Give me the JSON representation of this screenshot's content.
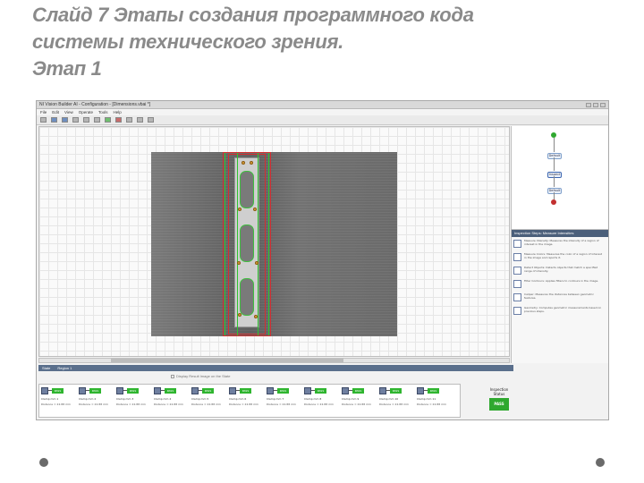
{
  "slide": {
    "title_lines": [
      "Слайд 7 Этапы создания программного кода",
      "системы технического зрения.",
      "Этап 1"
    ]
  },
  "app": {
    "window_title": "NI Vision Builder AI - Configuration - [Dimensions.vbai *]",
    "menu": [
      "File",
      "Edit",
      "View",
      "Operate",
      "Tools",
      "Help"
    ],
    "flow": {
      "start_label": "Start",
      "node1": "Default",
      "node2": "Inspect",
      "node3": "Default",
      "end_label": "End"
    },
    "panel_title": "Inspection Steps: Measure Intensities",
    "tools": [
      {
        "icon": "measure-intensity-icon",
        "text": "Measure Intensity: Measures the intensity of a region of interest in the image."
      },
      {
        "icon": "measure-colors-icon",
        "text": "Measure Colors: Measures the color of a region of interest in the image and reports it."
      },
      {
        "icon": "detect-objects-icon",
        "text": "Detect Objects: Detects objects that match a specified range of intensity."
      },
      {
        "icon": "filter-contours-icon",
        "text": "Filter Contours: Applies filters to contours in the image."
      },
      {
        "icon": "caliper-icon",
        "text": "Caliper: Measures the distances between geometric features."
      },
      {
        "icon": "geometry-icon",
        "text": "Geometry: Computes geometric measurements based on previous steps."
      }
    ],
    "bottom_tabs": [
      "State",
      "Region 1"
    ],
    "display_option": "Display Result Image on the State",
    "steps": [
      {
        "name": "Clamp mm 1",
        "value": "Distance = 22.88 mm"
      },
      {
        "name": "Clamp mm 2",
        "value": "Distance = 22.88 mm"
      },
      {
        "name": "Clamp mm 3",
        "value": "Distance = 22.88 mm"
      },
      {
        "name": "Clamp mm 4",
        "value": "Distance = 22.88 mm"
      },
      {
        "name": "Clamp mm 5",
        "value": "Distance = 22.88 mm"
      },
      {
        "name": "Clamp mm 6",
        "value": "Distance = 22.88 mm"
      },
      {
        "name": "Clamp mm 7",
        "value": "Distance = 22.88 mm"
      },
      {
        "name": "Clamp mm 8",
        "value": "Distance = 22.88 mm"
      },
      {
        "name": "Clamp mm 9",
        "value": "Distance = 22.88 mm"
      },
      {
        "name": "Clamp mm 10",
        "value": "Distance = 22.88 mm"
      },
      {
        "name": "Clamp mm 11",
        "value": "Distance = 22.88 mm"
      }
    ],
    "pass_label": "PASS",
    "inspection_status_label": "Inspection Status",
    "inspection_status_value": "PASS"
  },
  "colors": {
    "pass_green": "#2fb52f",
    "roi_red": "#d23030",
    "edge_green": "#2fc42f"
  }
}
